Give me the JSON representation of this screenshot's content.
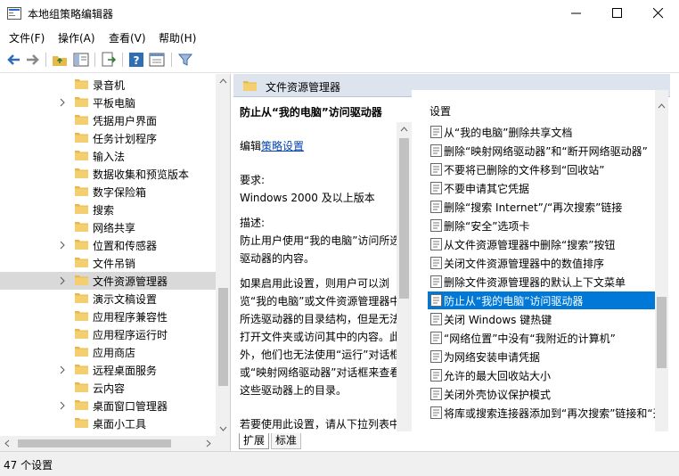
{
  "window": {
    "title": "本地组策略编辑器"
  },
  "menu": [
    "文件(F)",
    "操作(A)",
    "查看(V)",
    "帮助(H)"
  ],
  "tree": {
    "items": [
      {
        "label": "录音机",
        "expandable": false
      },
      {
        "label": "平板电脑",
        "expandable": true
      },
      {
        "label": "凭据用户界面",
        "expandable": false
      },
      {
        "label": "任务计划程序",
        "expandable": false
      },
      {
        "label": "输入法",
        "expandable": false
      },
      {
        "label": "数据收集和预览版本",
        "expandable": false
      },
      {
        "label": "数字保险箱",
        "expandable": false
      },
      {
        "label": "搜索",
        "expandable": false
      },
      {
        "label": "网络共享",
        "expandable": false
      },
      {
        "label": "位置和传感器",
        "expandable": true
      },
      {
        "label": "文件吊销",
        "expandable": false
      },
      {
        "label": "文件资源管理器",
        "expandable": true,
        "selected": true
      },
      {
        "label": "演示文稿设置",
        "expandable": false
      },
      {
        "label": "应用程序兼容性",
        "expandable": false
      },
      {
        "label": "应用程序运行时",
        "expandable": false
      },
      {
        "label": "应用商店",
        "expandable": false
      },
      {
        "label": "远程桌面服务",
        "expandable": true
      },
      {
        "label": "云内容",
        "expandable": false
      },
      {
        "label": "桌面窗口管理器",
        "expandable": true
      },
      {
        "label": "桌面小工具",
        "expandable": false
      }
    ]
  },
  "right": {
    "header": "文件资源管理器",
    "desc": {
      "title": "防止从“我的电脑”访问驱动器",
      "edit_prefix": "编辑",
      "edit_link": "策略设置",
      "req_label": "要求:",
      "req_value": "Windows 2000 及以上版本",
      "desc_label": "描述:",
      "desc_text": "防止用户使用“我的电脑”访问所选驱动器的内容。",
      "para1": "如果启用此设置，则用户可以浏览“我的电脑”或文件资源管理器中所选驱动器的目录结构，但是无法打开文件夹或访问其中的内容。此外，他们也无法使用“运行”对话框或“映射网络驱动器”对话框来查看这些驱动器上的目录。",
      "para2": "若要使用此设置，请从下拉列表中选择一个驱动器或多个驱动器的组合。若要允许访问所有驱动器目录，"
    },
    "settings_header": "设置",
    "settings": [
      "从“我的电脑”删除共享文档",
      "删除“映射网络驱动器”和“断开网络驱动器”",
      "不要将已删除的文件移到“回收站”",
      "不要申请其它凭据",
      "删除“搜索 Internet”/“再次搜索”链接",
      "删除“安全”选项卡",
      "从文件资源管理器中删除“搜索”按钮",
      "关闭文件资源管理器中的数值排序",
      "删除文件资源管理器的默认上下文菜单",
      "防止从“我的电脑”访问驱动器",
      "关闭 Windows 键热键",
      "“网络位置”中没有“我附近的计算机”",
      "为网络安装申请凭据",
      "允许的最大回收站大小",
      "关闭外壳协议保护模式",
      "将库或搜索连接器添加到“再次搜索”链接和“开"
    ],
    "selected_setting_index": 9,
    "tabs": [
      "扩展",
      "标准"
    ]
  },
  "status": {
    "text": "47 个设置"
  },
  "colors": {
    "selection": "#0078d7",
    "header_bg": "#dde4ee",
    "folder": "#e8b84a"
  }
}
